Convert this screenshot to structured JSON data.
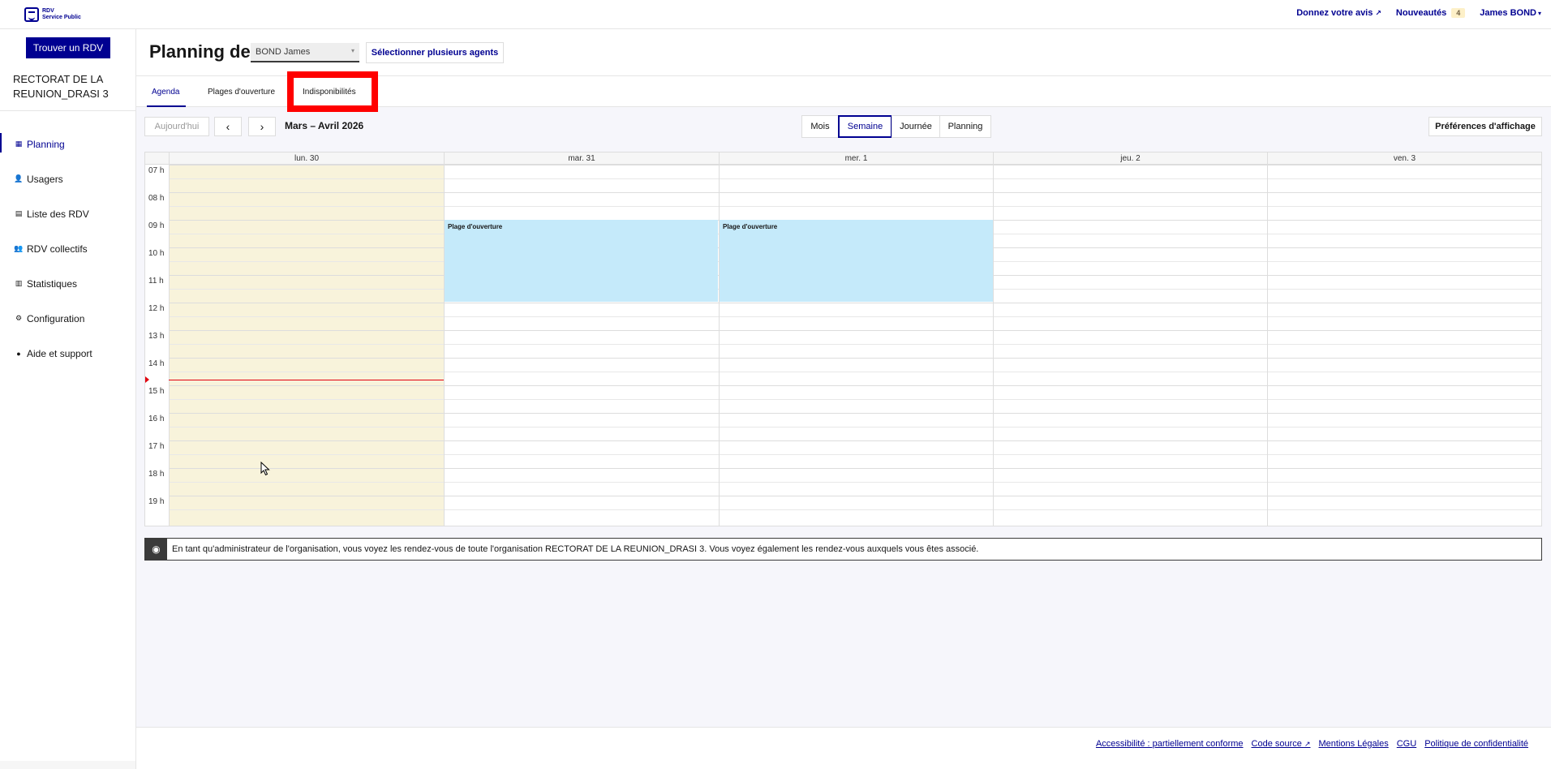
{
  "header": {
    "logo_line1": "RDV",
    "logo_line2": "Service Public",
    "feedback": "Donnez votre avis",
    "news": "Nouveautés",
    "news_badge": "4",
    "user": "James BOND"
  },
  "sidebar": {
    "find_button": "Trouver un RDV",
    "org": "RECTORAT DE LA REUNION_DRASI 3",
    "items": [
      {
        "label": "Planning",
        "icon": "calendar-icon",
        "glyph": "▦"
      },
      {
        "label": "Usagers",
        "icon": "users-icon",
        "glyph": "👤"
      },
      {
        "label": "Liste des RDV",
        "icon": "list-icon",
        "glyph": "▤"
      },
      {
        "label": "RDV collectifs",
        "icon": "group-icon",
        "glyph": "👥"
      },
      {
        "label": "Statistiques",
        "icon": "stats-icon",
        "glyph": "▥"
      },
      {
        "label": "Configuration",
        "icon": "gear-icon",
        "glyph": "⚙"
      },
      {
        "label": "Aide et support",
        "icon": "help-icon",
        "glyph": "●"
      }
    ]
  },
  "page": {
    "title": "Planning de",
    "agent": "BOND James",
    "multi_agents": "Sélectionner plusieurs agents"
  },
  "tabs": [
    "Agenda",
    "Plages d'ouverture",
    "Indisponibilités"
  ],
  "toolbar": {
    "today": "Aujourd'hui",
    "range": "Mars – Avril 2026",
    "views": [
      "Mois",
      "Semaine",
      "Journée",
      "Planning"
    ],
    "active_view": "Semaine",
    "prefs": "Préférences d'affichage"
  },
  "calendar": {
    "days": [
      "lun. 30",
      "mar. 31",
      "mer. 1",
      "jeu. 2",
      "ven. 3"
    ],
    "hours": [
      "07 h",
      "08 h",
      "09 h",
      "10 h",
      "11 h",
      "12 h",
      "13 h",
      "14 h",
      "15 h",
      "16 h",
      "17 h",
      "18 h",
      "19 h"
    ],
    "event_label": "Plage d'ouverture"
  },
  "info": "En tant qu'administrateur de l'organisation, vous voyez les rendez-vous de toute l'organisation RECTORAT DE LA REUNION_DRASI 3. Vous voyez également les rendez-vous auxquels vous êtes associé.",
  "footer": [
    "Accessibilité : partiellement conforme",
    "Code source",
    "Mentions Légales",
    "CGU",
    "Politique de confidentialité"
  ]
}
